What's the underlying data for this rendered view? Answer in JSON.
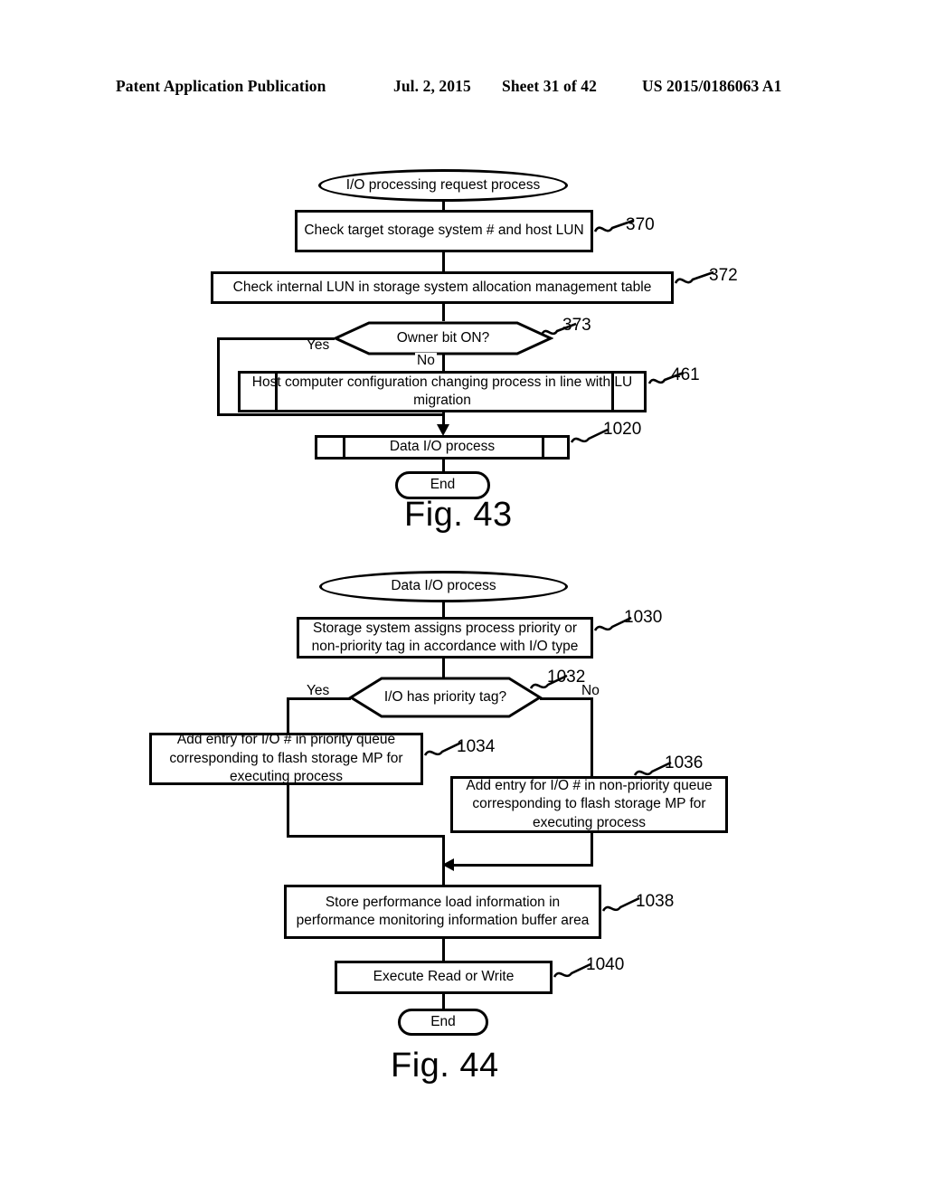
{
  "header": {
    "publication": "Patent Application Publication",
    "date": "Jul. 2, 2015",
    "sheet": "Sheet 31 of 42",
    "patent_number": "US 2015/0186063 A1"
  },
  "figures": [
    {
      "caption": "Fig. 43",
      "nodes": {
        "start": "I/O processing request process",
        "step_370": "Check target storage system # and host LUN",
        "step_372": "Check internal LUN in storage system allocation management table",
        "decision_373": "Owner bit ON?",
        "step_461": "Host computer configuration changing process in line with LU migration",
        "step_1020": "Data I/O process",
        "end": "End"
      },
      "branch_labels": {
        "yes": "Yes",
        "no": "No"
      },
      "ref_nums": {
        "n370": "370",
        "n372": "372",
        "n373": "373",
        "n461": "461",
        "n1020": "1020"
      }
    },
    {
      "caption": "Fig. 44",
      "nodes": {
        "start": "Data I/O process",
        "step_1030": "Storage system assigns process priority or non-priority tag in accordance with I/O type",
        "decision_1032": "I/O has priority tag?",
        "step_1034": "Add entry for I/O # in priority queue corresponding to flash storage MP for executing process",
        "step_1036": "Add entry for I/O # in non-priority queue corresponding to flash storage MP for executing process",
        "step_1038": "Store performance load information in performance monitoring information buffer area",
        "step_1040": "Execute Read or Write",
        "end": "End"
      },
      "branch_labels": {
        "yes": "Yes",
        "no": "No"
      },
      "ref_nums": {
        "n1030": "1030",
        "n1032": "1032",
        "n1034": "1034",
        "n1036": "1036",
        "n1038": "1038",
        "n1040": "1040"
      }
    }
  ],
  "colors": {
    "ink": "#000000",
    "paper": "#ffffff"
  }
}
